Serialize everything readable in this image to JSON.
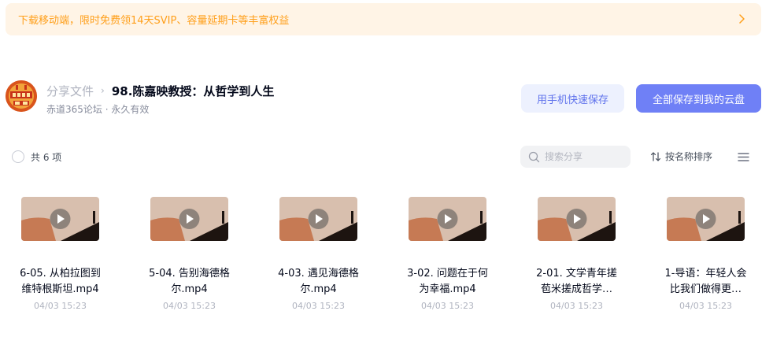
{
  "banner": {
    "text": "下载移动端，限时免费领14天SVIP、容量延期卡等丰富权益"
  },
  "share": {
    "breadcrumb_root": "分享文件",
    "breadcrumb_sep": "›",
    "folder_title": "98.陈嘉映教授：从哲学到人生",
    "owner_meta": "赤道365论坛 · 永久有效"
  },
  "actions": {
    "phone_save_label": "用手机快速保存",
    "save_all_label": "全部保存到我的云盘"
  },
  "toolbar": {
    "count_label": "共 6 项",
    "search_placeholder": "搜索分享",
    "sort_label": "按名称排序"
  },
  "files": [
    {
      "name_line1": "6-05. 从柏拉图到",
      "name_line2": "维特根斯坦.mp4",
      "date": "04/03 15:23"
    },
    {
      "name_line1": "5-04. 告别海德格",
      "name_line2": "尔.mp4",
      "date": "04/03 15:23"
    },
    {
      "name_line1": "4-03. 遇见海德格",
      "name_line2": "尔.mp4",
      "date": "04/03 15:23"
    },
    {
      "name_line1": "3-02. 问题在于何",
      "name_line2": "为幸福.mp4",
      "date": "04/03 15:23"
    },
    {
      "name_line1": "2-01. 文学青年搓",
      "name_line2": "苞米搓成哲学…",
      "date": "04/03 15:23"
    },
    {
      "name_line1": "1-导语：年轻人会",
      "name_line2": "比我们做得更…",
      "date": "04/03 15:23"
    }
  ],
  "colors": {
    "banner_bg": "#fff4e6",
    "banner_text": "#ff9f1a",
    "primary": "#6f80f6",
    "secondary_bg": "#edf1fe",
    "secondary_text": "#5f72ec"
  }
}
